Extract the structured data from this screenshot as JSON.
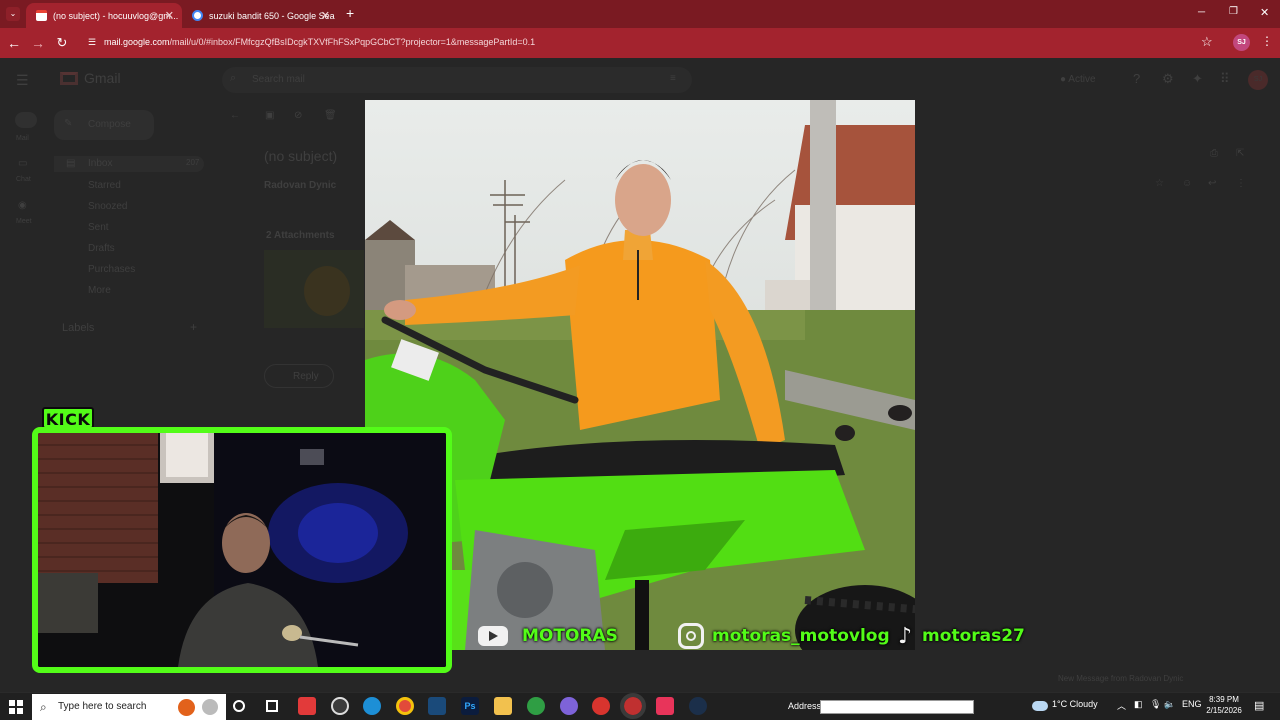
{
  "browser": {
    "tabs": [
      {
        "label": "(no subject) - hocuuvlog@gm...",
        "active": true
      },
      {
        "label": "suzuki bandit 650 - Google Sea",
        "active": false
      }
    ],
    "new_tab": "+",
    "url_host": "mail.google.com",
    "url_path": "/mail/u/0/#inbox/FMfcgzQfBsIDcgkTXVfFhFSxPqpGCbCT?projector=1&messagePartId=0.1",
    "profile_initials": "SJ",
    "window_controls": {
      "minimize": "─",
      "restore": "❐",
      "close": "✕"
    }
  },
  "gmail": {
    "app_name": "Gmail",
    "search_placeholder": "Search mail",
    "status": "Active",
    "compose_label": "Compose",
    "rail": [
      "Mail",
      "Chat",
      "Meet"
    ],
    "nav": [
      {
        "label": "Inbox",
        "count": "207"
      },
      {
        "label": "Starred",
        "count": ""
      },
      {
        "label": "Snoozed",
        "count": ""
      },
      {
        "label": "Sent",
        "count": ""
      },
      {
        "label": "Drafts",
        "count": ""
      },
      {
        "label": "Purchases",
        "count": ""
      },
      {
        "label": "More",
        "count": ""
      }
    ],
    "labels_heading": "Labels",
    "subject": "(no subject)",
    "sender": "Radovan Dynic",
    "attachments": "2 Attachments",
    "reply_label": "Reply",
    "new_message_notice": "New Message from Radovan Dynic",
    "user_initials": "SJ"
  },
  "overlay": {
    "kick_label": "KICK",
    "youtube": "MOTORAS",
    "instagram": "motoras_motovlog",
    "tiktok": "motoras27",
    "accent_color": "#53fc18"
  },
  "taskbar": {
    "search_placeholder": "Type here to search",
    "address_label": "Address",
    "weather": "1°C  Cloudy",
    "language": "ENG",
    "time": "8:39 PM",
    "date": "2/15/2026"
  }
}
